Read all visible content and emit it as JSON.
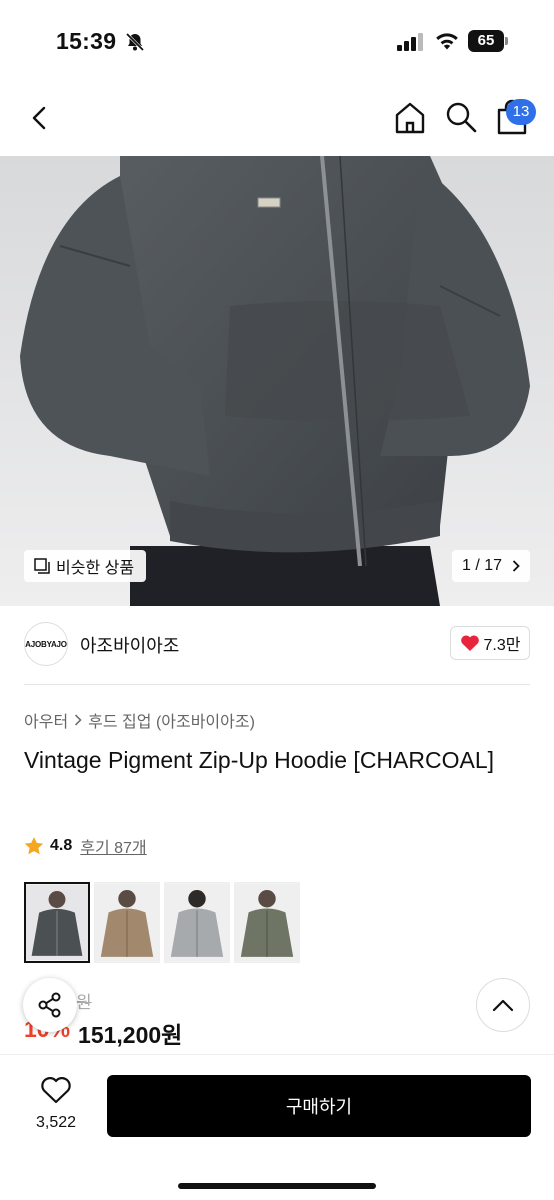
{
  "status_bar": {
    "time": "15:39",
    "battery": "65"
  },
  "nav": {
    "cart_count": "13"
  },
  "hero": {
    "similar_label": "비슷한 상품",
    "page_current": "1",
    "page_total": "17",
    "page_text": "1 / 17",
    "logo_text": "AJOBYAJO"
  },
  "brand": {
    "logo_text": "AJOBYAJO",
    "name": "아조바이아조",
    "likes": "7.3만"
  },
  "breadcrumb": {
    "category": "아우터",
    "subcategory": "후드 집업 (아조바이아조)"
  },
  "product": {
    "title": "Vintage Pigment Zip-Up Hoodie [CHARCOAL]",
    "rating": "4.8",
    "reviews": "후기 87개",
    "original_price_visible": "00원",
    "discount_visible": "10%",
    "price": "151,200원"
  },
  "thumbnails": [
    {
      "color": "charcoal",
      "hex": "#4b5053",
      "selected": true
    },
    {
      "color": "beige",
      "hex": "#a2886d",
      "selected": false
    },
    {
      "color": "light-gray",
      "hex": "#a7aaad",
      "selected": false
    },
    {
      "color": "khaki",
      "hex": "#6e7564",
      "selected": false
    }
  ],
  "bottom_bar": {
    "wish_count": "3,522",
    "buy_label": "구매하기"
  },
  "colors": {
    "accent_blue": "#2f6fe8",
    "sale_red": "#f0412b",
    "heart_red": "#e8243b"
  }
}
